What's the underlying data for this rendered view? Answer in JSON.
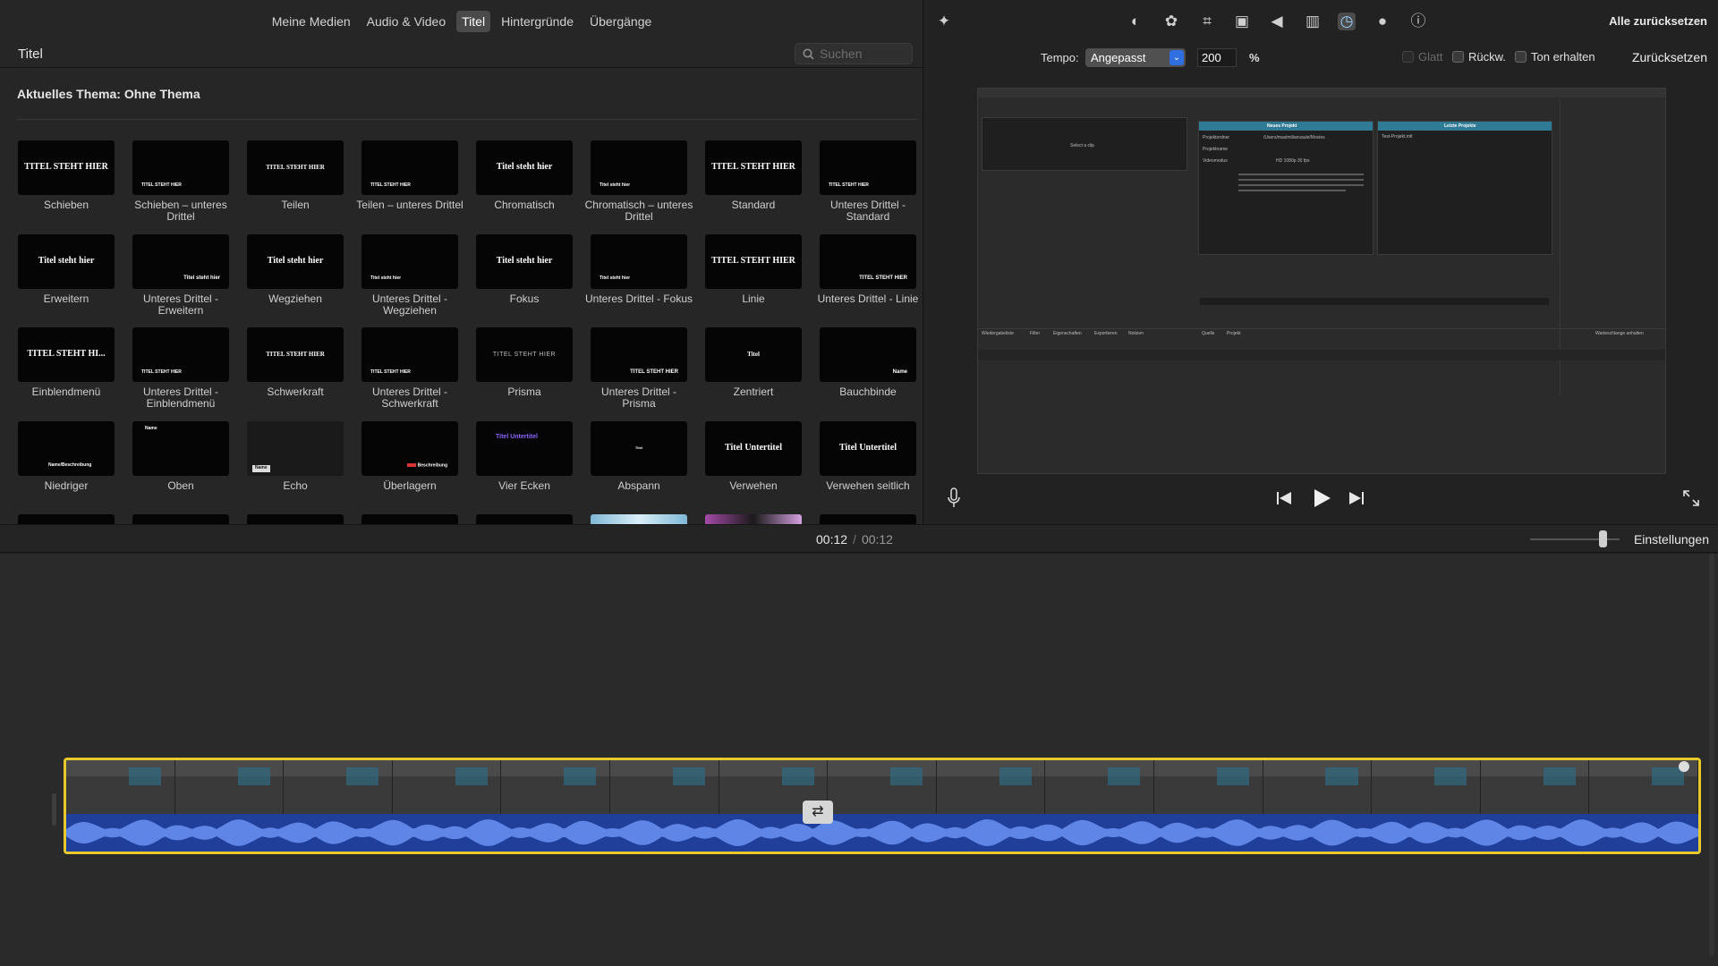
{
  "media_tabs": [
    {
      "label": "Meine Medien",
      "active": false
    },
    {
      "label": "Audio & Video",
      "active": false
    },
    {
      "label": "Titel",
      "active": true
    },
    {
      "label": "Hintergründe",
      "active": false
    },
    {
      "label": "Übergänge",
      "active": false
    }
  ],
  "browser": {
    "title": "Titel",
    "search_placeholder": "Suchen",
    "theme_label": "Aktuelles Thema: Ohne Thema"
  },
  "titles": [
    {
      "label": "Schieben",
      "thumb": "TITEL STEHT HIER",
      "style": "center"
    },
    {
      "label": "Schieben – unteres Drittel",
      "thumb": "TITEL STEHT HIER",
      "style": "lower"
    },
    {
      "label": "Teilen",
      "thumb": "TITEL STEHT HIER",
      "style": "center small"
    },
    {
      "label": "Teilen – unteres Drittel",
      "thumb": "TITEL STEHT HIER",
      "style": "lower"
    },
    {
      "label": "Chromatisch",
      "thumb": "Titel steht hier",
      "style": "center"
    },
    {
      "label": "Chromatisch – unteres Drittel",
      "thumb": "Titel steht hier",
      "style": "lower"
    },
    {
      "label": "Standard",
      "thumb": "TITEL STEHT HIER",
      "style": "center"
    },
    {
      "label": "Unteres Drittel - Standard",
      "thumb": "TITEL STEHT HIER",
      "style": "lower"
    },
    {
      "label": "Erweitern",
      "thumb": "Titel steht hier",
      "style": "center"
    },
    {
      "label": "Unteres Drittel - Erweitern",
      "thumb": "Titel steht hier",
      "style": "lower-right"
    },
    {
      "label": "Wegziehen",
      "thumb": "Titel steht hier",
      "style": "center"
    },
    {
      "label": "Unteres Drittel - Wegziehen",
      "thumb": "Titel steht hier",
      "style": "lower"
    },
    {
      "label": "Fokus",
      "thumb": "Titel steht hier",
      "style": "center"
    },
    {
      "label": "Unteres Drittel - Fokus",
      "thumb": "Titel steht hier",
      "style": "lower"
    },
    {
      "label": "Linie",
      "thumb": "TITEL STEHT HIER",
      "style": "center"
    },
    {
      "label": "Unteres Drittel - Linie",
      "thumb": "TITEL STEHT HIER",
      "style": "lower-right"
    },
    {
      "label": "Einblendmenü",
      "thumb": "TITEL STEHT HI...",
      "style": "center"
    },
    {
      "label": "Unteres Drittel - Einblendmenü",
      "thumb": "TITEL STEHT HIER",
      "style": "lower"
    },
    {
      "label": "Schwerkraft",
      "thumb": "TITEL STEHT HIER",
      "style": "center small"
    },
    {
      "label": "Unteres Drittel - Schwerkraft",
      "thumb": "TITEL STEHT HIER",
      "style": "lower"
    },
    {
      "label": "Prisma",
      "thumb": "TITEL STEHT HIER",
      "style": "center small gray"
    },
    {
      "label": "Unteres Drittel - Prisma",
      "thumb": "TITEL STEHT HIER",
      "style": "lower-right"
    },
    {
      "label": "Zentriert",
      "thumb": "Titel",
      "style": "center small"
    },
    {
      "label": "Bauchbinde",
      "thumb": "Name",
      "style": "lower-right"
    },
    {
      "label": "Niedriger",
      "thumb": "Name/Beschreibung",
      "style": "bottom"
    },
    {
      "label": "Oben",
      "thumb": "Name",
      "style": "top"
    },
    {
      "label": "Echo",
      "thumb": "Name",
      "style": "echo"
    },
    {
      "label": "Überlagern",
      "thumb": "Beschreibung",
      "style": "red"
    },
    {
      "label": "Vier Ecken",
      "thumb": "Titel Untertitel",
      "style": "purple"
    },
    {
      "label": "Abspann",
      "thumb": "Titel",
      "style": "credits"
    },
    {
      "label": "Verwehen",
      "thumb": "Titel Untertitel",
      "style": "center"
    },
    {
      "label": "Verwehen seitlich",
      "thumb": "Titel Untertitel",
      "style": "center"
    }
  ],
  "viewer": {
    "reset_all": "Alle zurücksetzen",
    "speed_label": "Tempo:",
    "speed_mode": "Angepasst",
    "speed_value": "200",
    "speed_unit": "%",
    "smooth_label": "Glatt",
    "reverse_label": "Rückw.",
    "preserve_pitch_label": "Ton erhalten",
    "reset_label": "Zurücksetzen",
    "active_tool": "speed-icon",
    "tools": [
      "color-balance-icon",
      "color-correction-icon",
      "crop-icon",
      "stabilization-icon",
      "volume-icon",
      "equalizer-icon",
      "speed-icon",
      "filter-icon",
      "info-icon"
    ],
    "preview": {
      "select_clip": "Select a clip",
      "new_project": "Neues Projekt",
      "recent_projects": "Letzte Projekte",
      "project_folder_label": "Projektordner",
      "project_folder": "/Users/maximilianvaule/Movies",
      "project_name_label": "Projektname",
      "video_mode_label": "Videomodus",
      "video_mode": "HD 1080p 30 fps",
      "recent_file": "Test-Projekt.mlt",
      "panels_bottom": [
        "Wiedergabeliste",
        "Filter",
        "Eigenschaften",
        "Exportieren",
        "Notizen"
      ],
      "source": "Quelle",
      "project": "Projekt",
      "queue": "Warteschlange anhalten"
    }
  },
  "timebar": {
    "current": "00:12",
    "separator": "/",
    "duration": "00:12",
    "settings": "Einstellungen"
  },
  "colors": {
    "clip_border": "#e9c92a",
    "audio": "#1f3f9a",
    "accent": "#2f6fe0"
  }
}
